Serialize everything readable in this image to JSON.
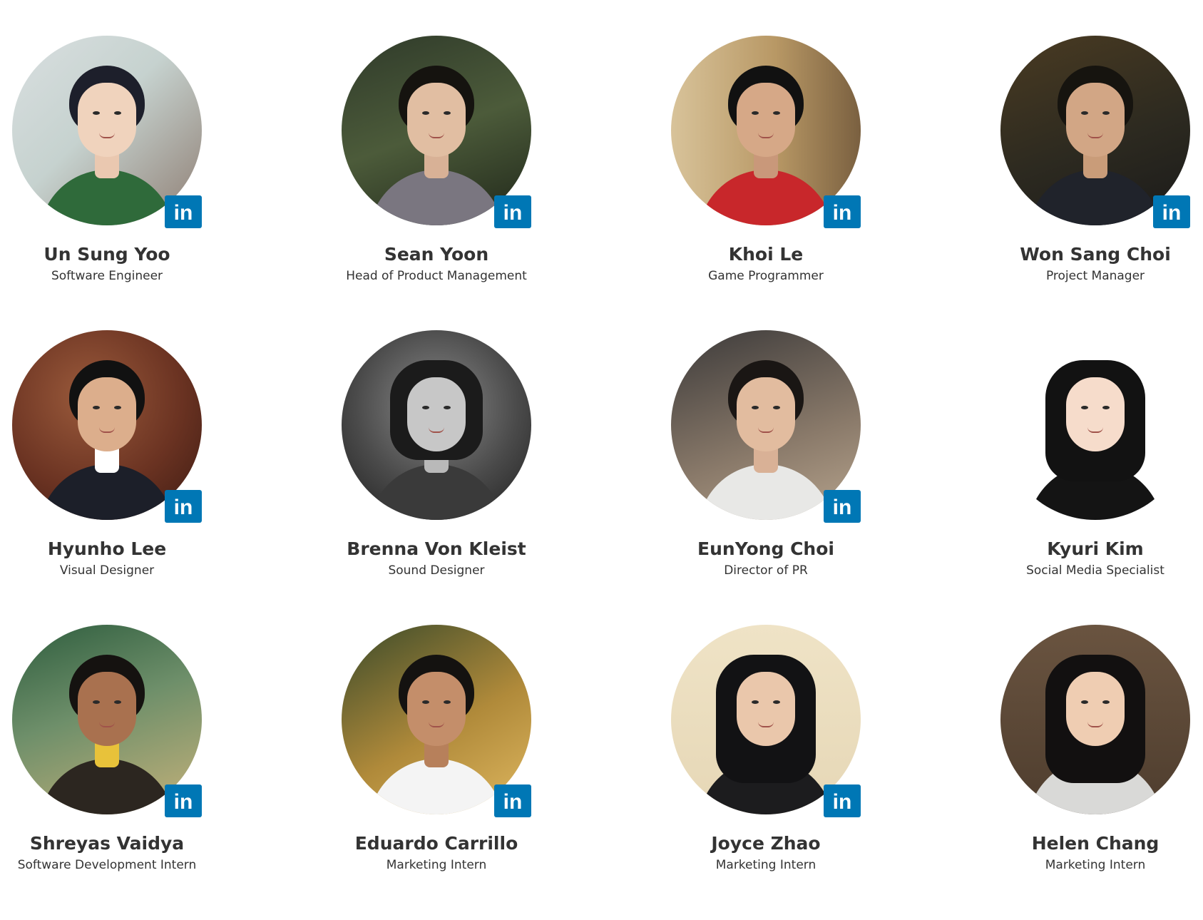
{
  "linkedin_badge": {
    "label": "in",
    "icon": "linkedin-icon",
    "color": "#0077b5"
  },
  "members": [
    {
      "name": "Un Sung Yoo",
      "role": "Software Engineer",
      "linkedin": true
    },
    {
      "name": "Sean Yoon",
      "role": "Head of Product Management",
      "linkedin": true
    },
    {
      "name": "Khoi Le",
      "role": "Game Programmer",
      "linkedin": true
    },
    {
      "name": "Won Sang Choi",
      "role": "Project Manager",
      "linkedin": true
    },
    {
      "name": "Hyunho Lee",
      "role": "Visual Designer",
      "linkedin": true
    },
    {
      "name": "Brenna Von Kleist",
      "role": "Sound Designer",
      "linkedin": false
    },
    {
      "name": "EunYong Choi",
      "role": "Director of PR",
      "linkedin": true
    },
    {
      "name": "Kyuri Kim",
      "role": "Social Media Specialist",
      "linkedin": false
    },
    {
      "name": "Shreyas Vaidya",
      "role": "Software Development Intern",
      "linkedin": true
    },
    {
      "name": "Eduardo Carrillo",
      "role": "Marketing Intern",
      "linkedin": true
    },
    {
      "name": "Joyce Zhao",
      "role": "Marketing Intern",
      "linkedin": true
    },
    {
      "name": "Helen Chang",
      "role": "Marketing Intern",
      "linkedin": false
    }
  ]
}
